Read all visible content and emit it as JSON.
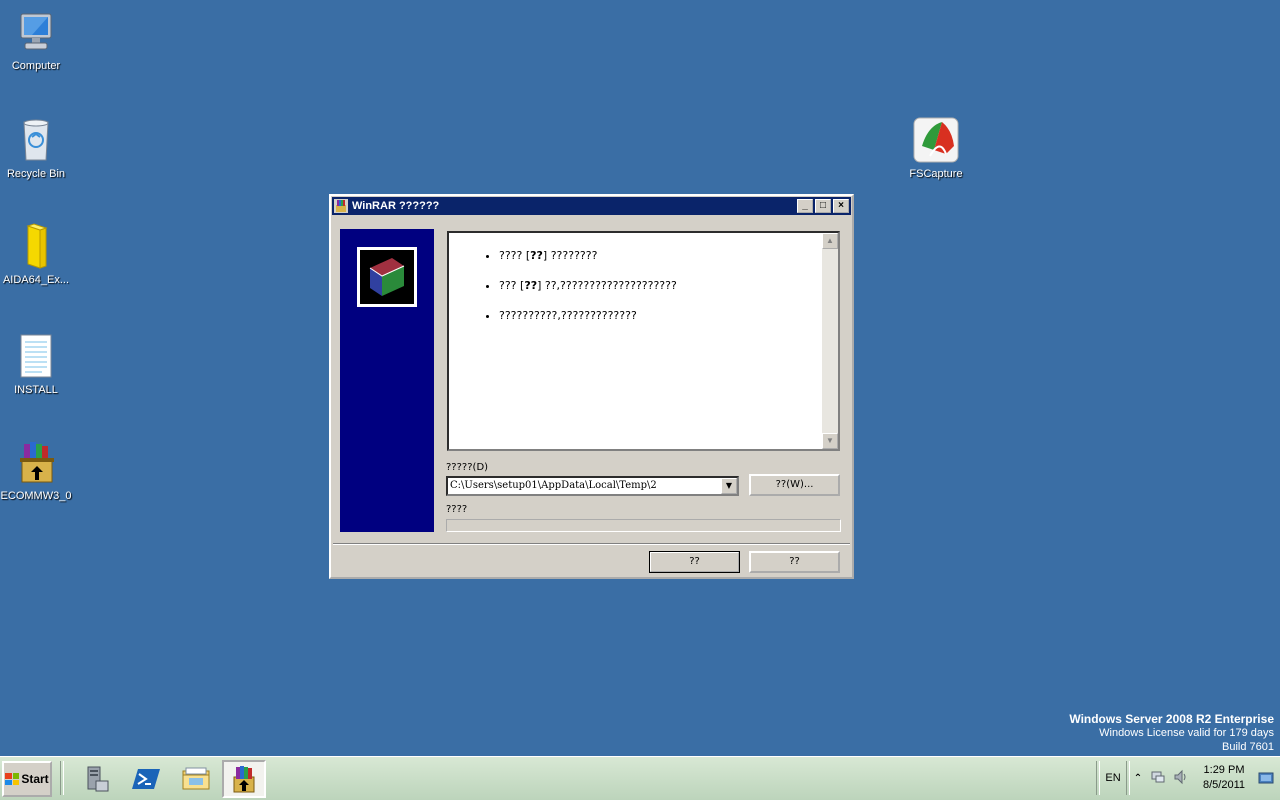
{
  "desktop": {
    "icons": [
      {
        "label": "Computer",
        "icon": "computer-icon"
      },
      {
        "label": "Recycle Bin",
        "icon": "recycle-bin-icon"
      },
      {
        "label": "AIDA64_Ex...",
        "icon": "folder-icon"
      },
      {
        "label": "INSTALL",
        "icon": "text-file-icon"
      },
      {
        "label": "ECOMMW3_0",
        "icon": "winrar-archive-icon"
      },
      {
        "label": "FSCapture",
        "icon": "fscapture-icon"
      }
    ]
  },
  "watermark": {
    "line1": "Windows Server 2008 R2 Enterprise",
    "line2": "Windows License valid for 179 days",
    "line3": "Build 7601"
  },
  "dialog": {
    "title": "WinRAR ??????",
    "controls": {
      "minimize": "_",
      "maximize": "□",
      "close": "×"
    },
    "messages": [
      {
        "pre": "???? [",
        "bold": "??",
        "post": "] ????????"
      },
      {
        "pre": "??? [",
        "bold": "??",
        "post": "] ??,????????????????????"
      },
      {
        "pre": "??????????,?????????????",
        "bold": "",
        "post": ""
      }
    ],
    "dest_label": "?????(D)",
    "dest_value": "C:\\Users\\setup01\\AppData\\Local\\Temp\\2",
    "browse_label": "??(W)...",
    "progress_label": "????",
    "progress_value": 0,
    "ok_label": "??",
    "cancel_label": "??"
  },
  "taskbar": {
    "start_label": "Start",
    "pinned": [
      "server-manager-icon",
      "powershell-icon",
      "explorer-icon",
      "winrar-icon"
    ],
    "language": "EN",
    "time": "1:29 PM",
    "date": "8/5/2011"
  },
  "colors": {
    "desktop": "#3a6ea5",
    "titlebar": "#0a246a",
    "side_panel": "#000080"
  }
}
